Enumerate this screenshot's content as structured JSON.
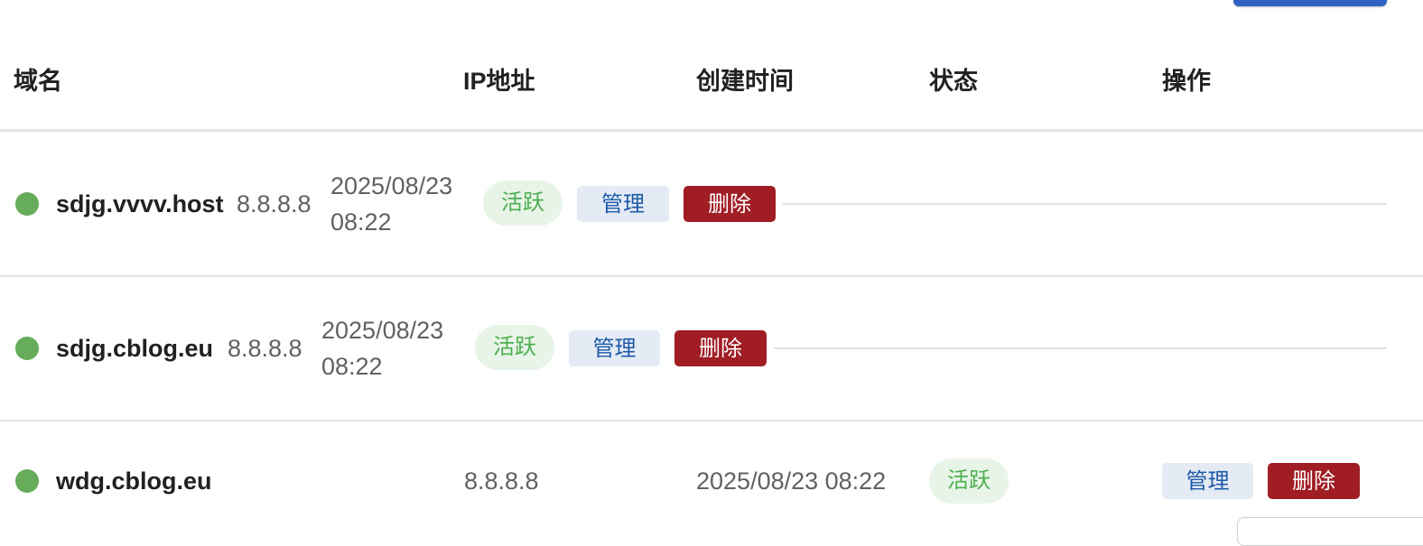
{
  "table": {
    "headers": {
      "domain": "域名",
      "ip": "IP地址",
      "created": "创建时间",
      "status": "状态",
      "actions": "操作"
    },
    "rows": [
      {
        "domain": "sdjg.vvvv.host",
        "ip": "8.8.8.8",
        "created_line1": "2025/08/23",
        "created_line2": "08:22",
        "status": "活跃",
        "manage_label": "管理",
        "delete_label": "删除"
      },
      {
        "domain": "sdjg.cblog.eu",
        "ip": "8.8.8.8",
        "created_line1": "2025/08/23",
        "created_line2": "08:22",
        "status": "活跃",
        "manage_label": "管理",
        "delete_label": "删除"
      },
      {
        "domain": "wdg.cblog.eu",
        "ip": "8.8.8.8",
        "created": "2025/08/23 08:22",
        "status": "活跃",
        "manage_label": "管理",
        "delete_label": "删除"
      }
    ]
  },
  "colors": {
    "status_dot": "#66ac5b",
    "status_badge_bg": "#e8f4e8",
    "status_badge_text": "#4caf50",
    "manage_bg": "#e4ebf5",
    "manage_text": "#1e5aa8",
    "delete_bg": "#a01d24",
    "delete_text": "#ffffff",
    "primary_button": "#2f65c2"
  }
}
